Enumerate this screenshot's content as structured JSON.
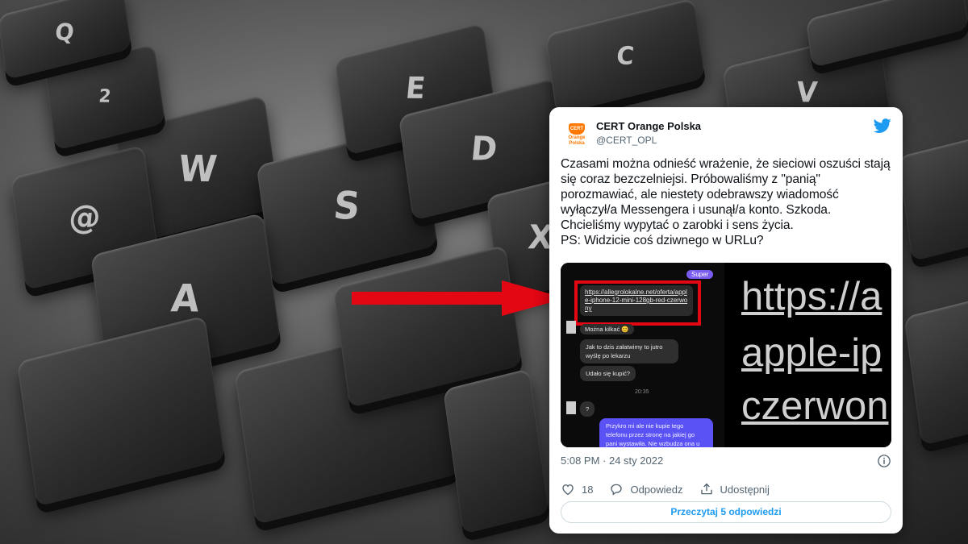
{
  "background": {
    "keys": [
      "W",
      "S",
      "@",
      "2",
      "A",
      "E",
      "D",
      "X",
      "V",
      "Q",
      "C"
    ]
  },
  "tweet": {
    "display_name": "CERT Orange Polska",
    "handle": "@CERT_OPL",
    "avatar": {
      "icon": "orange-shield-logo",
      "badge_text": "CERT",
      "brand_text": "Orange Polska",
      "color": "#ff7900"
    },
    "text": "Czasami można odnieść wrażenie, że sieciowi oszuści stają się coraz bezczelniejsi. Próbowaliśmy z \"panią\" porozmawiać, ale niestety odebrawszy wiadomość wyłączył/a Messengera i usunął/a konto. Szkoda. Chcieliśmy wypytać o zarobki i sens życia.\nPS: Widzicie coś dziwnego w URLu?",
    "timestamp": "5:08 PM · 24 sty 2022",
    "likes": "18",
    "reply_label": "Odpowiedz",
    "share_label": "Udostępnij",
    "read_replies_label": "Przeczytaj 5 odpowiedzi",
    "accent_color": "#1d9bf0",
    "media": {
      "chat": {
        "pill": "Super",
        "link": "https://allegrolokalne.net/oferta/apple-iphone-12-mini-128gb-red-czerwony",
        "messages": [
          "Można kilkać 😊",
          "Jak to dzis załatwimy to jutro wyślę po lekarzu",
          "Udało się kupić?",
          "?"
        ],
        "time": "20:35",
        "my_message": "Przykro mi ale nie kupie tego telefonu przez stronę na jakiej go pani wystawiła. Nie wzbudza ona u"
      },
      "zoom_lines": [
        "https://a",
        "apple-ip",
        "czerwon"
      ],
      "highlight_color": "#e30613"
    }
  }
}
